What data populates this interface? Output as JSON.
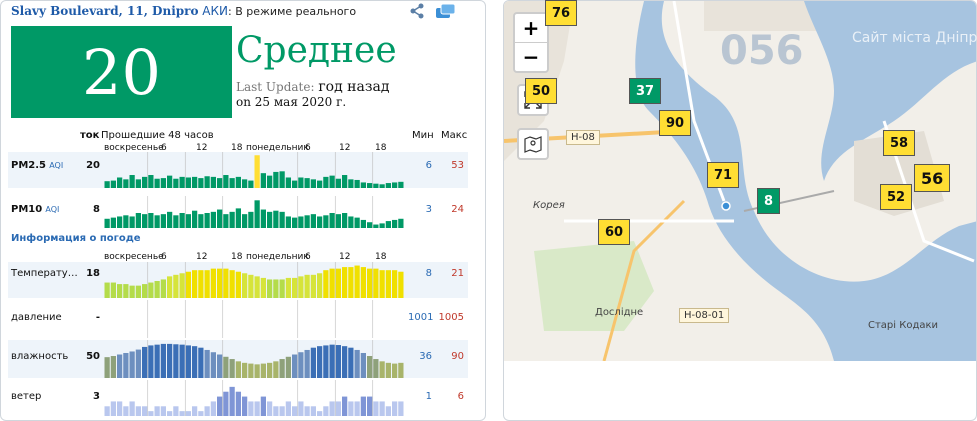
{
  "header": {
    "station": "Slavy Boulevard, 11, Dnipro",
    "aqi_label": "АКИ",
    "realtime": ": В режиме реального"
  },
  "aqi": {
    "value": "20",
    "status": "Среднее",
    "color": "#009966",
    "last_update_label": "Last Update:",
    "ago": "год назад",
    "date": "on 25 мая 2020 г."
  },
  "columns": {
    "current": "ток",
    "history": "Прошедшие 48 часов",
    "min": "Мин",
    "max": "Макс"
  },
  "day_labels": {
    "sunday": "воскресенье",
    "monday": "понедельник",
    "h6": "6",
    "h12": "12",
    "h18": "18"
  },
  "weather_title": "Информация о погоде",
  "rows": [
    {
      "label": "PM2.5",
      "sub": "AQI",
      "current": "20",
      "min": "6",
      "max": "53",
      "color": "#009966",
      "highlight": "#ffde33",
      "values": [
        11,
        12,
        17,
        14,
        21,
        14,
        18,
        21,
        15,
        16,
        20,
        15,
        18,
        17,
        18,
        16,
        19,
        18,
        16,
        21,
        16,
        18,
        14,
        12,
        53,
        24,
        20,
        26,
        27,
        17,
        12,
        17,
        16,
        14,
        12,
        18,
        20,
        15,
        21,
        14,
        13,
        9,
        8,
        7,
        6,
        8,
        9,
        10
      ]
    },
    {
      "label": "PM10",
      "sub": "AQI",
      "current": "8",
      "min": "3",
      "max": "24",
      "color": "#009966",
      "highlight": "#ffde33",
      "values": [
        8,
        9,
        10,
        11,
        10,
        13,
        12,
        13,
        11,
        12,
        14,
        11,
        13,
        12,
        15,
        12,
        13,
        14,
        16,
        12,
        14,
        17,
        12,
        14,
        24,
        16,
        14,
        15,
        14,
        10,
        9,
        10,
        11,
        12,
        10,
        11,
        13,
        12,
        13,
        10,
        9,
        7,
        5,
        3,
        4,
        6,
        7,
        8
      ]
    },
    {
      "label": "Температу…",
      "current": "18",
      "min": "8",
      "max": "21",
      "values": [
        10,
        10,
        9,
        9,
        8,
        8,
        9,
        10,
        11,
        12,
        14,
        15,
        16,
        17,
        18,
        18,
        18,
        19,
        19,
        19,
        18,
        17,
        16,
        15,
        14,
        13,
        12,
        12,
        12,
        13,
        13,
        14,
        15,
        15,
        16,
        18,
        19,
        19,
        20,
        20,
        21,
        20,
        19,
        19,
        18,
        18,
        18,
        17
      ]
    },
    {
      "label": "давление",
      "current": "-",
      "min": "1001",
      "max": "1005"
    },
    {
      "label": "влажность",
      "current": "50",
      "min": "36",
      "max": "90",
      "values": [
        55,
        58,
        62,
        66,
        70,
        75,
        82,
        86,
        88,
        90,
        90,
        89,
        88,
        86,
        84,
        80,
        74,
        68,
        62,
        56,
        50,
        44,
        40,
        38,
        36,
        38,
        40,
        44,
        50,
        56,
        62,
        68,
        74,
        80,
        84,
        86,
        88,
        87,
        84,
        80,
        74,
        66,
        58,
        50,
        44,
        40,
        38,
        40
      ]
    },
    {
      "label": "ветер",
      "current": "3",
      "min": "1",
      "max": "6",
      "values": [
        2,
        3,
        3,
        2,
        3,
        2,
        2,
        1,
        2,
        2,
        1,
        2,
        1,
        1,
        2,
        1,
        2,
        3,
        4,
        5,
        6,
        5,
        4,
        3,
        3,
        4,
        3,
        2,
        2,
        3,
        2,
        3,
        2,
        2,
        1,
        2,
        3,
        3,
        4,
        3,
        3,
        4,
        4,
        3,
        3,
        2,
        3,
        3
      ]
    }
  ],
  "map": {
    "zoom_in": "+",
    "zoom_out": "−",
    "markers": [
      {
        "value": "76",
        "color": "yellow"
      },
      {
        "value": "50",
        "color": "yellow"
      },
      {
        "value": "37",
        "color": "green"
      },
      {
        "value": "90",
        "color": "yellow"
      },
      {
        "value": "71",
        "color": "yellow"
      },
      {
        "value": "8",
        "color": "green"
      },
      {
        "value": "60",
        "color": "yellow"
      },
      {
        "value": "58",
        "color": "yellow"
      },
      {
        "value": "52",
        "color": "yellow"
      },
      {
        "value": "56",
        "color": "yellow"
      }
    ],
    "labels": {
      "korea": "Корея",
      "doslidne": "Дослідне",
      "stari_kodaky": "Старі Кодаки",
      "road_h08": "H-08",
      "road_h0801": "H-08-01",
      "watermark": "056",
      "watermark_text": "Сайт міста Дніпра"
    },
    "colors": {
      "water": "#a7c4e0",
      "land": "#f2efe9",
      "park": "#d9e9c8"
    }
  }
}
